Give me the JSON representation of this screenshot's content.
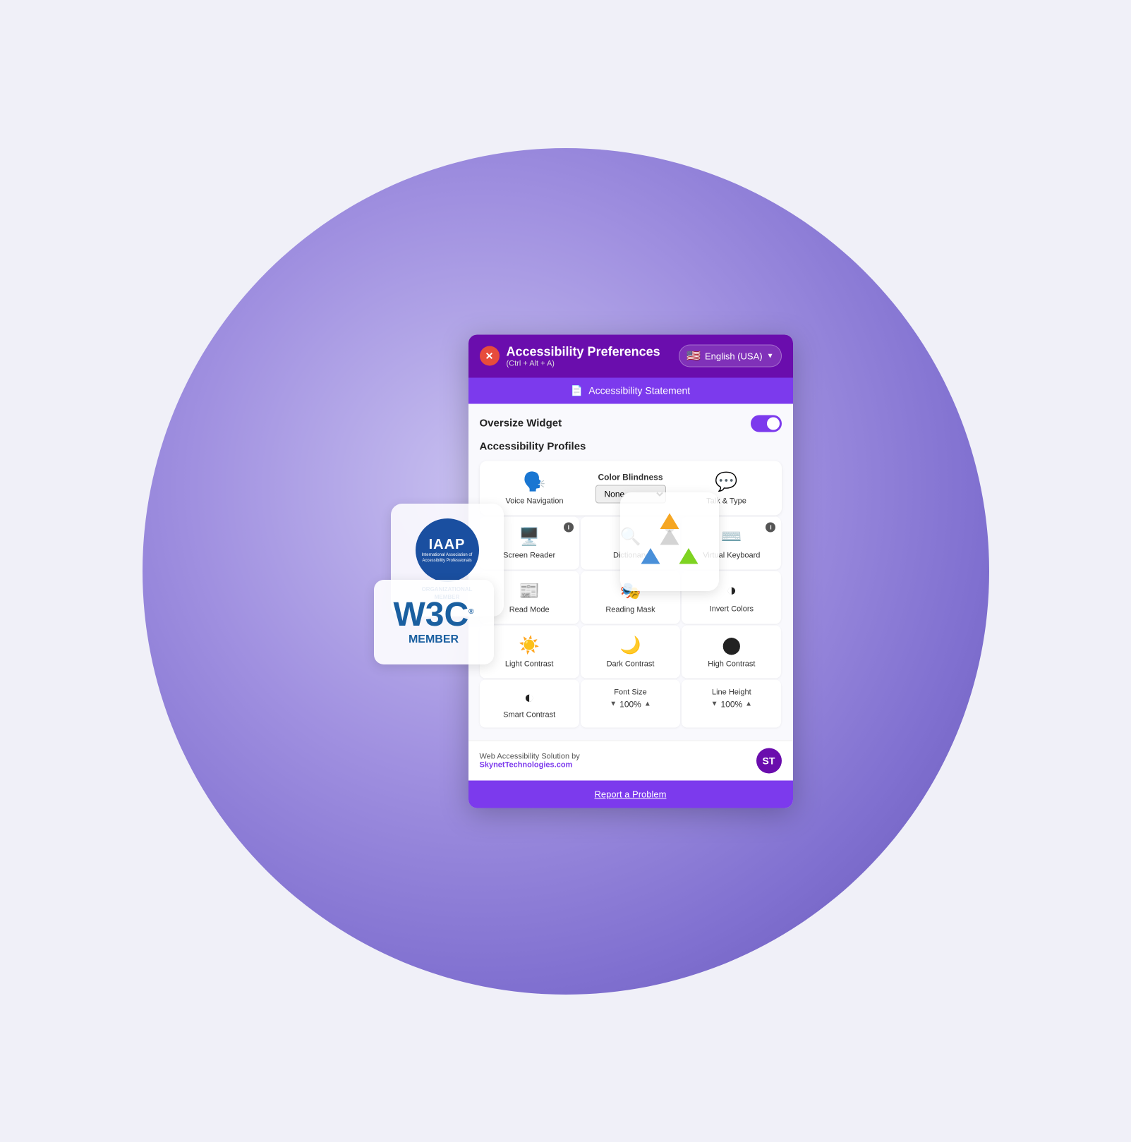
{
  "circle": {
    "visible": true
  },
  "iaap": {
    "circle_text": "IAAP",
    "sub_text": "International Association of Accessibility Professionals",
    "org_line1": "ORGANIZATIONAL",
    "org_line2": "MEMBER"
  },
  "w3c": {
    "text": "W3C",
    "registered": "®",
    "member": "MEMBER"
  },
  "widget": {
    "close_label": "✕",
    "title": "Accessibility Preferences",
    "shortcut": "(Ctrl + Alt + A)",
    "lang_label": "English (USA)",
    "statement_label": "Accessibility Statement",
    "oversize_label": "Oversize Widget",
    "profiles_label": "Accessibility Profiles",
    "voice_nav_label": "Voice Navigation",
    "color_blindness_label": "Color Blindness",
    "color_blindness_value": "None",
    "talk_type_label": "Talk & Type",
    "screen_reader_label": "Screen Reader",
    "dictionary_label": "Dictionary",
    "virtual_keyboard_label": "Virtual Keyboard",
    "read_mode_label": "Read Mode",
    "reading_mask_label": "Reading Mask",
    "invert_colors_label": "Invert Colors",
    "light_contrast_label": "Light Contrast",
    "dark_contrast_label": "Dark Contrast",
    "high_contrast_label": "High Contrast",
    "smart_contrast_label": "Smart Contrast",
    "font_size_label": "Font Size",
    "font_size_value": "100%",
    "line_height_label": "Line Height",
    "line_height_value": "100%",
    "footer_text_1": "Web Accessibility Solution by",
    "footer_link": "SkynetTechnologies.com",
    "footer_logo": "ST",
    "report_label": "Report a Problem"
  }
}
